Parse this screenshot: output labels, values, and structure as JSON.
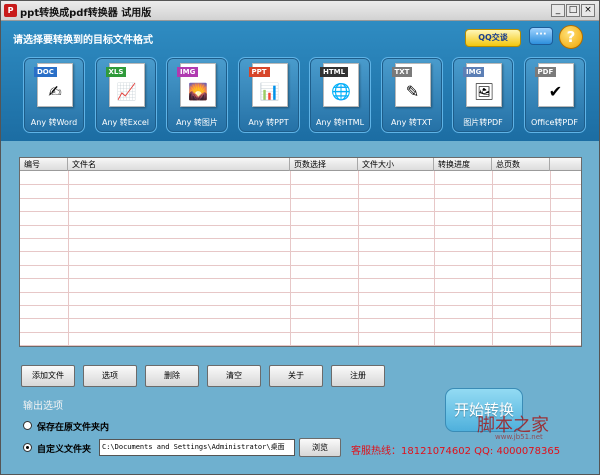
{
  "window": {
    "title": "ppt转换成pdf转换器 试用版",
    "app_icon": "pdf-app-icon",
    "controls": {
      "minimize": "_",
      "maximize": "□",
      "close": "×"
    }
  },
  "header": {
    "prompt": "请选择要转换到的目标文件格式",
    "qq_label": "QQ交谈",
    "chat_icon": "speech-bubble-icon",
    "help_icon": "question-mark-icon",
    "help_label": "?"
  },
  "conversions": [
    {
      "tag": "DOC",
      "label": "Any 转Word",
      "tag_color": "#2a6fc7",
      "icon": "word-document-icon",
      "glyph": "✍"
    },
    {
      "tag": "XLS",
      "label": "Any 转Excel",
      "tag_color": "#2f9a3a",
      "icon": "excel-chart-icon",
      "glyph": "📈"
    },
    {
      "tag": "IMG",
      "label": "Any 转图片",
      "tag_color": "#b03ab0",
      "icon": "image-icon",
      "glyph": "🌄"
    },
    {
      "tag": "PPT",
      "label": "Any 转PPT",
      "tag_color": "#d6452a",
      "icon": "powerpoint-icon",
      "glyph": "📊"
    },
    {
      "tag": "HTML",
      "label": "Any 转HTML",
      "tag_color": "#333333",
      "icon": "html-globe-icon",
      "glyph": "🌐"
    },
    {
      "tag": "TXT",
      "label": "Any 转TXT",
      "tag_color": "#7a7a7a",
      "icon": "text-file-icon",
      "glyph": "✎"
    },
    {
      "tag": "IMG",
      "label": "图片转PDF",
      "tag_color": "#5c7fb5",
      "icon": "image-to-pdf-icon",
      "glyph": "🖼"
    },
    {
      "tag": "PDF",
      "label": "Office转PDF",
      "tag_color": "#7a7a7a",
      "icon": "office-to-pdf-icon",
      "glyph": "✔"
    }
  ],
  "table": {
    "columns": [
      "编号",
      "文件名",
      "页数选择",
      "文件大小",
      "转换进度",
      "总页数"
    ],
    "rows": []
  },
  "actions": {
    "add": "添加文件",
    "options": "选项",
    "delete": "删除",
    "clear": "清空",
    "about": "关于",
    "register": "注册"
  },
  "output": {
    "heading": "输出选项",
    "option_original": "保存在原文件夹内",
    "option_custom": "自定义文件夹",
    "selected": "custom",
    "path": "C:\\Documents and Settings\\Administrator\\桌面",
    "browse": "浏览"
  },
  "start_label": "开始转换",
  "hotline": "客服热线：18121074602 QQ: 4000078365",
  "watermark": {
    "text": "脚本之家",
    "url": "www.jb51.net"
  }
}
